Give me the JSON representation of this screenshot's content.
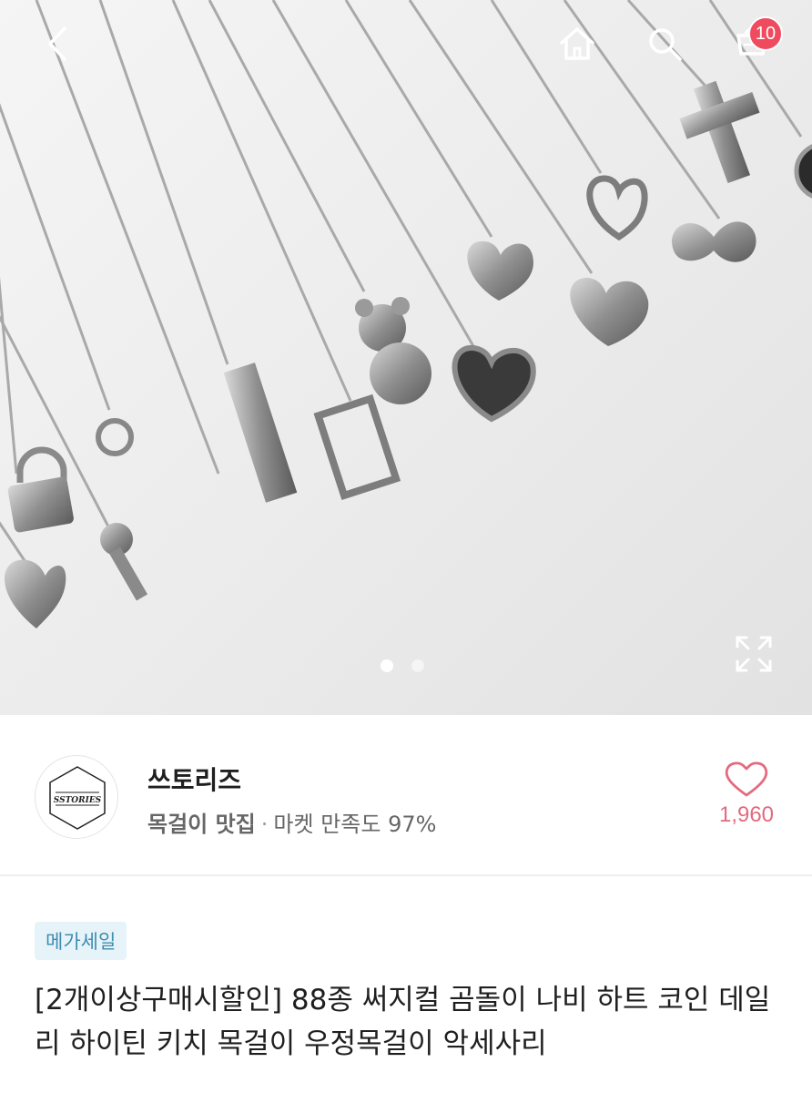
{
  "header": {
    "cart_count": "10"
  },
  "icons": {
    "back": "chevron-left-icon",
    "home": "home-icon",
    "search": "search-icon",
    "cart": "cart-icon",
    "expand": "expand-icon",
    "heart": "heart-icon"
  },
  "gallery": {
    "total_pages": 2,
    "current_page": 1
  },
  "shop": {
    "logo_text": "SSTORIES",
    "name": "쓰토리즈",
    "tagline": "목걸이 맛집",
    "separator": "·",
    "satisfaction": "마켓 만족도 97%",
    "likes": "1,960"
  },
  "product": {
    "badge": "메가세일",
    "title": "[2개이상구매시할인] 88종 써지컬 곰돌이 나비 하트 코인 데일리 하이틴 키치 목걸이 우정목걸이 악세사리"
  },
  "colors": {
    "badge_bg": "#e6f4fa",
    "badge_text": "#3f8cb0",
    "like_pink": "#e46a7f",
    "cart_badge": "#ef4b5f"
  }
}
